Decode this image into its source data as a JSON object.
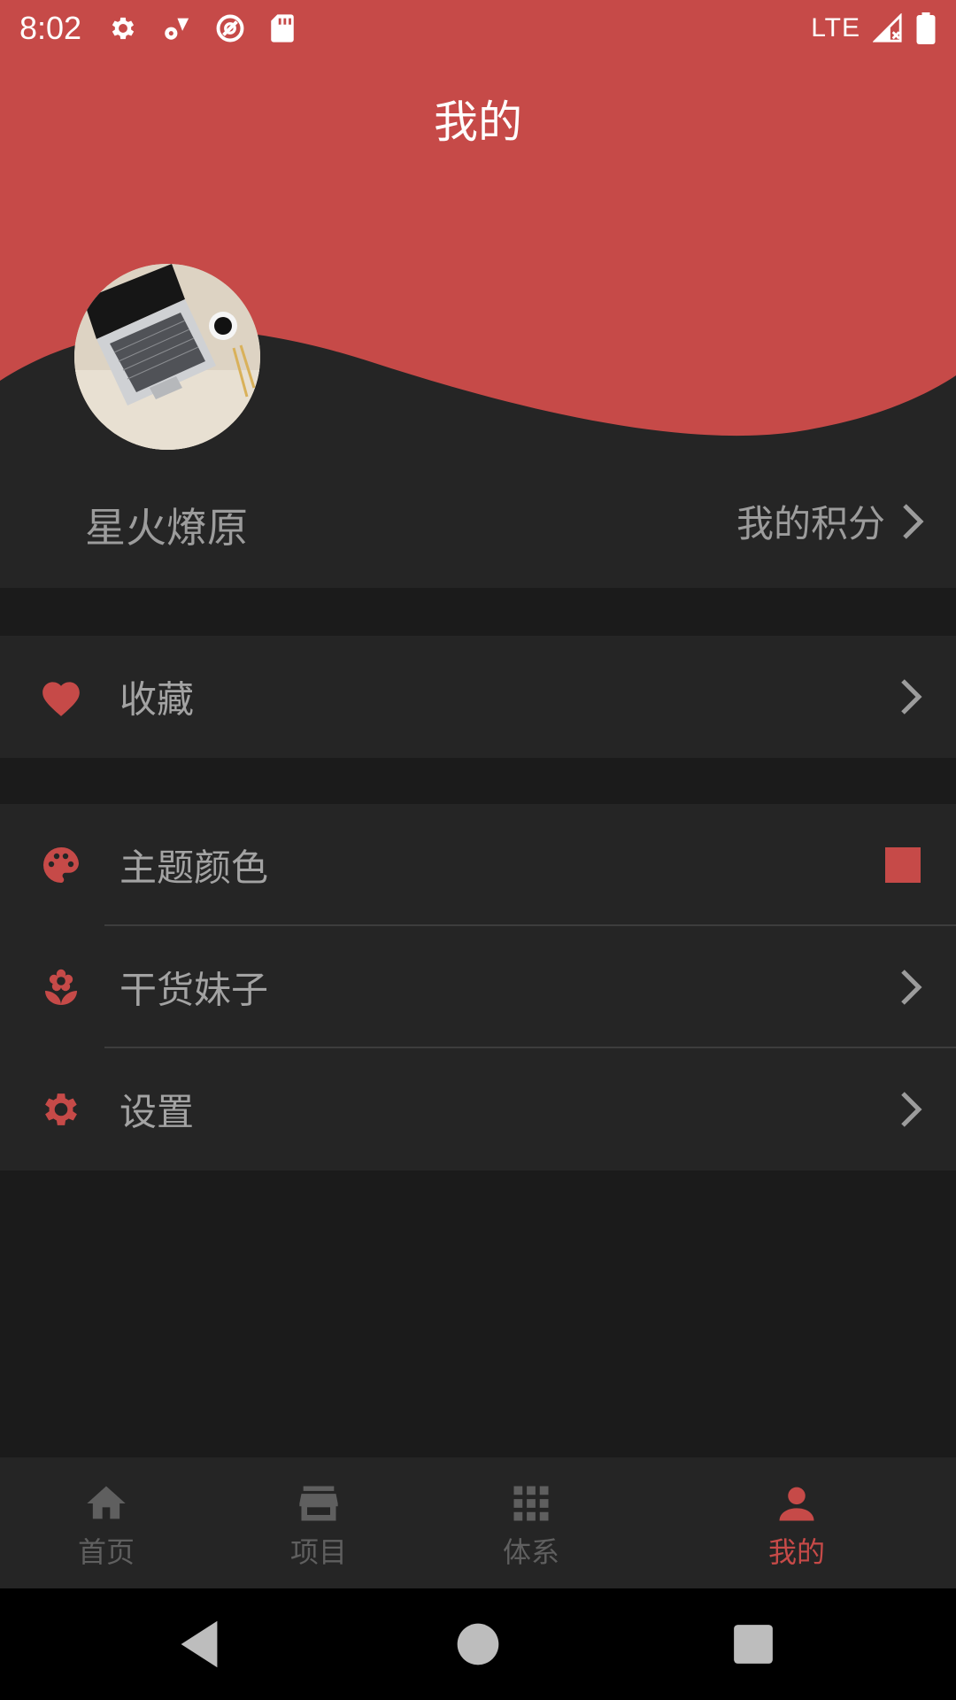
{
  "status_bar": {
    "time": "8:02",
    "network": "LTE",
    "icons": [
      "gear-icon",
      "fan-icon",
      "data-saver-icon",
      "sd-card-icon",
      "signal-icon",
      "battery-icon"
    ]
  },
  "header": {
    "title": "我的",
    "username": "星火燎原",
    "points_label": "我的积分"
  },
  "sections": {
    "favorites": {
      "label": "收藏",
      "icon": "heart-icon"
    },
    "theme": {
      "label": "主题颜色",
      "icon": "palette-icon",
      "swatch_color": "#c64a48"
    },
    "girls": {
      "label": "干货妹子",
      "icon": "flower-icon"
    },
    "settings": {
      "label": "设置",
      "icon": "gear-icon"
    }
  },
  "bottom_nav": {
    "items": [
      {
        "label": "首页",
        "icon": "home-icon",
        "active": false
      },
      {
        "label": "项目",
        "icon": "store-icon",
        "active": false
      },
      {
        "label": "体系",
        "icon": "grid-icon",
        "active": false
      },
      {
        "label": "我的",
        "icon": "person-icon",
        "active": true
      }
    ]
  },
  "colors": {
    "accent": "#c64a48",
    "background": "#1b1b1b",
    "card": "#252525",
    "text_secondary": "#9c9c9c",
    "nav_inactive": "#5f5f5f"
  }
}
